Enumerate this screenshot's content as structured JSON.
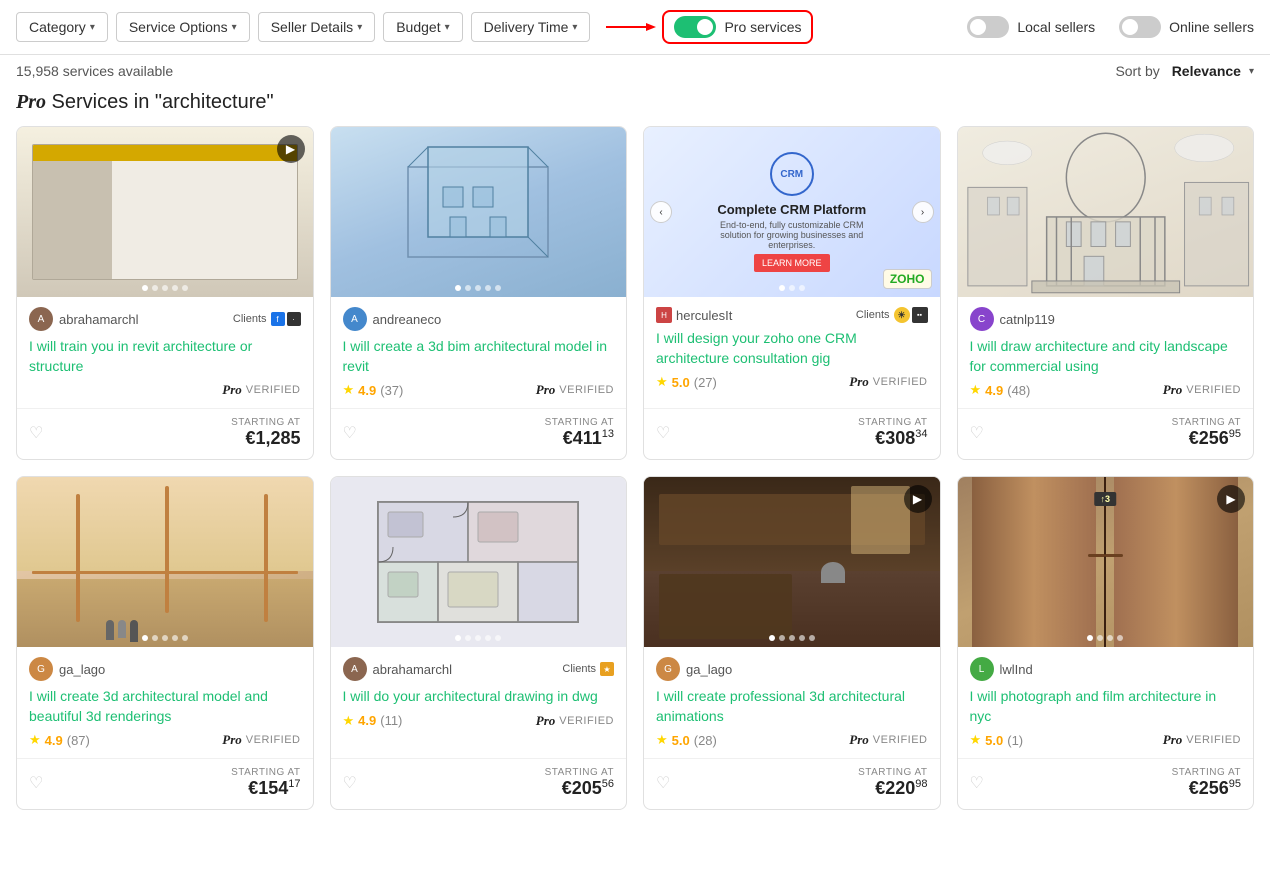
{
  "filterBar": {
    "category": "Category",
    "serviceOptions": "Service Options",
    "sellerDetails": "Seller Details",
    "budget": "Budget",
    "deliveryTime": "Delivery Time",
    "proServices": "Pro services",
    "localSellers": "Local sellers",
    "onlineSellers": "Online sellers"
  },
  "resultsBar": {
    "count": "15,958 services available",
    "sortBy": "Sort by",
    "sortValue": "Relevance"
  },
  "heading": {
    "pro": "Pro",
    "text": " Services in \"architecture\""
  },
  "cards": [
    {
      "id": 1,
      "sellerName": "abrahamarchl",
      "hasClients": true,
      "title": "I will train you in revit architecture or structure",
      "rating": null,
      "ratingCount": null,
      "proVerified": true,
      "price": "€1,285",
      "priceSup": "",
      "imgClass": "img-1",
      "hasPlay": true,
      "dots": [
        true,
        false,
        false,
        false,
        false
      ],
      "hasCarouselArrows": false
    },
    {
      "id": 2,
      "sellerName": "andreaneco",
      "hasClients": false,
      "title": "I will create a 3d bim architectural model in revit",
      "rating": "4.9",
      "ratingCount": "(37)",
      "proVerified": true,
      "price": "€411",
      "priceSup": "13",
      "imgClass": "img-2",
      "hasPlay": false,
      "dots": [
        true,
        false,
        false,
        false,
        false
      ],
      "hasCarouselArrows": false
    },
    {
      "id": 3,
      "sellerName": "herculesIt",
      "hasClients": true,
      "isHercules": true,
      "title": "I will design your zoho one CRM architecture consultation gig",
      "titleColor": "#1dbf73",
      "rating": "5.0",
      "ratingCount": "(27)",
      "proVerified": true,
      "price": "€308",
      "priceSup": "34",
      "imgClass": "crm-image",
      "hasPlay": false,
      "dots": [
        true,
        false,
        false
      ],
      "hasCarouselArrows": true
    },
    {
      "id": 4,
      "sellerName": "catnlp119",
      "hasClients": false,
      "title": "I will draw architecture and city landscape for commercial using",
      "rating": "4.9",
      "ratingCount": "(48)",
      "proVerified": true,
      "price": "€256",
      "priceSup": "95",
      "imgClass": "img-4",
      "hasPlay": false,
      "dots": [],
      "hasCarouselArrows": false
    },
    {
      "id": 5,
      "sellerName": "ga_lago",
      "hasClients": false,
      "title": "I will create 3d architectural model and beautiful 3d renderings",
      "rating": "4.9",
      "ratingCount": "(87)",
      "proVerified": true,
      "price": "€154",
      "priceSup": "17",
      "imgClass": "img-5",
      "hasPlay": false,
      "dots": [
        true,
        false,
        false,
        false,
        false
      ],
      "hasCarouselArrows": false
    },
    {
      "id": 6,
      "sellerName": "abrahamarchl",
      "hasClients": true,
      "title": "I will do your architectural drawing in dwg",
      "rating": "4.9",
      "ratingCount": "(11)",
      "proVerified": true,
      "price": "€205",
      "priceSup": "56",
      "imgClass": "img-6",
      "hasPlay": false,
      "dots": [
        true,
        false,
        false,
        false,
        false
      ],
      "hasCarouselArrows": false
    },
    {
      "id": 7,
      "sellerName": "ga_lago",
      "hasClients": false,
      "title": "I will create professional 3d architectural animations",
      "rating": "5.0",
      "ratingCount": "(28)",
      "proVerified": true,
      "price": "€220",
      "priceSup": "98",
      "imgClass": "img-7",
      "hasPlay": true,
      "dots": [
        true,
        false,
        false,
        false,
        false
      ],
      "hasCarouselArrows": false
    },
    {
      "id": 8,
      "sellerName": "lwlInd",
      "hasClients": false,
      "title": "I will photograph and film architecture in nyc",
      "rating": "5.0",
      "ratingCount": "(1)",
      "proVerified": true,
      "price": "€256",
      "priceSup": "95",
      "imgClass": "img-8",
      "hasPlay": true,
      "dots": [
        true,
        false,
        false,
        false
      ],
      "hasCarouselArrows": false
    }
  ]
}
